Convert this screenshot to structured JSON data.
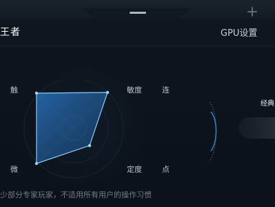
{
  "header": {
    "mode_title": "王者",
    "gpu_tab": "GPU设置"
  },
  "radar": {
    "labels": {
      "left_top": "触",
      "right_top": "敏度",
      "right_top_2": "连",
      "left_bottom": "微",
      "right_bottom": "定度",
      "right_bottom_2": "点"
    }
  },
  "side_panel": {
    "label": "经典"
  },
  "footer": {
    "note": "少部分专家玩家，不适用所有用户的操作习惯"
  },
  "icons": {
    "plus": "plus-icon"
  },
  "colors": {
    "accent": "#1d8fe6",
    "accent_soft": "#2c76b5",
    "text_muted": "#6f7c89"
  }
}
